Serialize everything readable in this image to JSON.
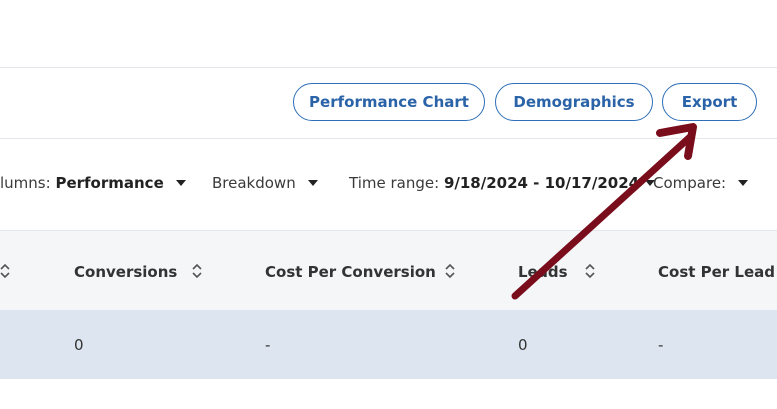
{
  "toolbar": {
    "performance_chart": "Performance Chart",
    "demographics": "Demographics",
    "export": "Export"
  },
  "filters": {
    "columns_label": "lumns:",
    "columns_value": "Performance",
    "breakdown_label": "Breakdown",
    "time_range_label": "Time range:",
    "time_range_value": "9/18/2024 - 10/17/2024",
    "compare_label": "Compare:"
  },
  "table": {
    "columns": [
      "Conversions",
      "Cost Per Conversion",
      "Leads",
      "Cost Per Lead"
    ],
    "rows": [
      [
        "0",
        "-",
        "0",
        "-"
      ]
    ]
  },
  "annotation": {
    "arrow_color": "#7a0d1c"
  },
  "colors": {
    "accent": "#2b63a8",
    "header_bg": "#f4f6f8",
    "row_bg": "#dde6f0"
  }
}
